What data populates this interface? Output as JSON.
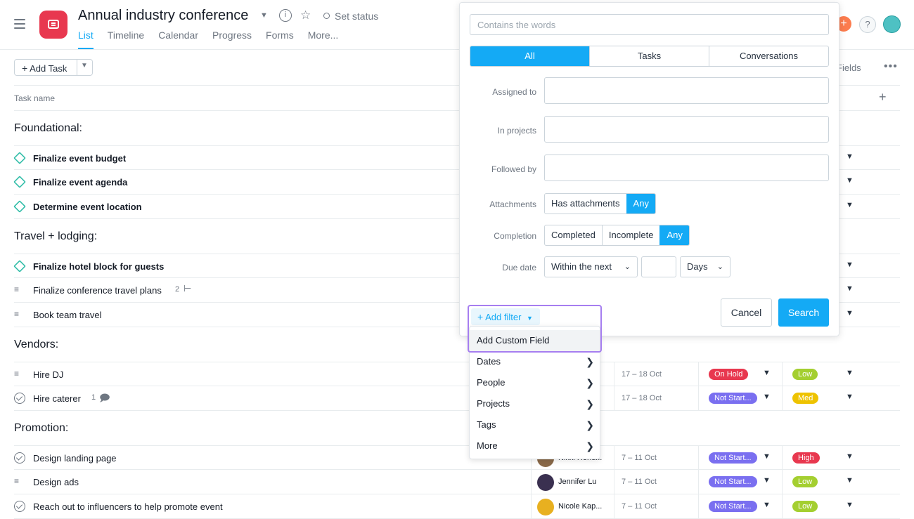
{
  "header": {
    "title": "Annual industry conference",
    "set_status": "Set status",
    "tabs": [
      "List",
      "Timeline",
      "Calendar",
      "Progress",
      "Forms",
      "More..."
    ],
    "help": "?"
  },
  "toolbar": {
    "add_task": "Add Task",
    "fields": "Fields"
  },
  "list": {
    "column_task_name": "Task name",
    "sections": [
      "Foundational:",
      "Travel + lodging:",
      "Vendors:",
      "Promotion:"
    ],
    "tasks": [
      {
        "name": "Finalize event budget"
      },
      {
        "name": "Finalize event agenda"
      },
      {
        "name": "Determine event location"
      },
      {
        "name": "Finalize hotel block for guests"
      },
      {
        "name": "Finalize conference travel plans",
        "count": "2"
      },
      {
        "name": "Book team travel"
      },
      {
        "name": "Hire DJ",
        "date": "17 – 18 Oct",
        "status": "On Hold",
        "priority": "Low"
      },
      {
        "name": "Hire caterer",
        "count": "1",
        "date": "17 – 18 Oct",
        "status": "Not Start...",
        "priority": "Med"
      },
      {
        "name": "Design landing page",
        "assignee": "Nikki Hend...",
        "date": "7 – 11 Oct",
        "status": "Not Start...",
        "priority": "High"
      },
      {
        "name": "Design ads",
        "assignee": "Jennifer Lu",
        "date": "7 – 11 Oct",
        "status": "Not Start...",
        "priority": "Low"
      },
      {
        "name": "Reach out to influencers to help promote event",
        "assignee": "Nicole Kap...",
        "date": "7 – 11 Oct",
        "status": "Not Start...",
        "priority": "Low"
      }
    ],
    "colors": {
      "on_hold": "#e8384f",
      "not_started": "#7a6ff0",
      "low": "#a4cf30",
      "med": "#eec300",
      "high": "#e8384f"
    }
  },
  "search_panel": {
    "words_placeholder": "Contains the words",
    "scope": [
      "All",
      "Tasks",
      "Conversations"
    ],
    "labels": {
      "assigned": "Assigned to",
      "projects": "In projects",
      "followed": "Followed by",
      "attachments": "Attachments",
      "completion": "Completion",
      "due": "Due date"
    },
    "attachments": [
      "Has attachments",
      "Any"
    ],
    "completion": [
      "Completed",
      "Incomplete",
      "Any"
    ],
    "due_range": "Within the next",
    "due_unit": "Days",
    "cancel": "Cancel",
    "search": "Search",
    "add_filter": "Add filter"
  },
  "filter_menu": {
    "items": [
      "Add Custom Field",
      "Dates",
      "People",
      "Projects",
      "Tags",
      "More"
    ]
  }
}
